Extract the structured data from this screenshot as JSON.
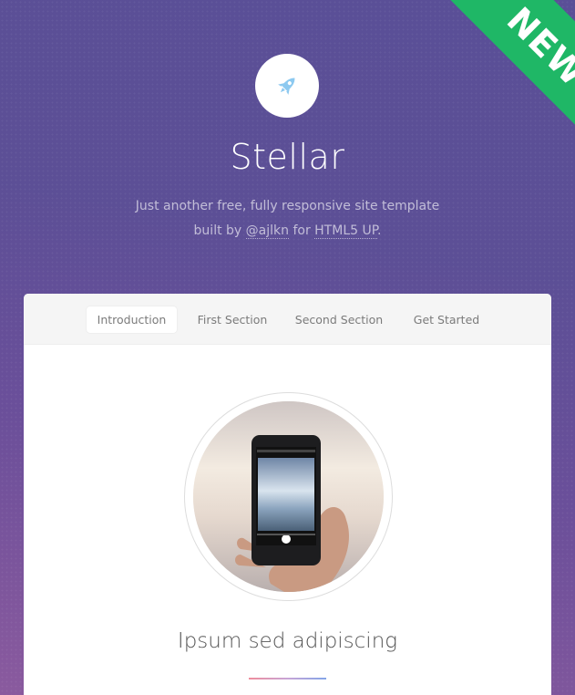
{
  "ribbon": {
    "text": "NEW",
    "color": "#1fb766"
  },
  "header": {
    "logo_icon": "rocket-icon",
    "title": "Stellar",
    "tagline_line1": "Just another free, fully responsive site template",
    "tagline_built_by": "built by",
    "tagline_author": "@ajlkn",
    "tagline_for": "for",
    "tagline_brand": "HTML5 UP",
    "tagline_period": "."
  },
  "nav": {
    "items": [
      {
        "label": "Introduction",
        "active": true
      },
      {
        "label": "First Section",
        "active": false
      },
      {
        "label": "Second Section",
        "active": false
      },
      {
        "label": "Get Started",
        "active": false
      }
    ]
  },
  "intro": {
    "image": "hand-holding-phone-photo",
    "heading": "Ipsum sed adipiscing"
  },
  "colors": {
    "accent_icon": "#8cc9f0",
    "background_top": "#5a4f97",
    "background_bottom": "#8a5a9e"
  }
}
